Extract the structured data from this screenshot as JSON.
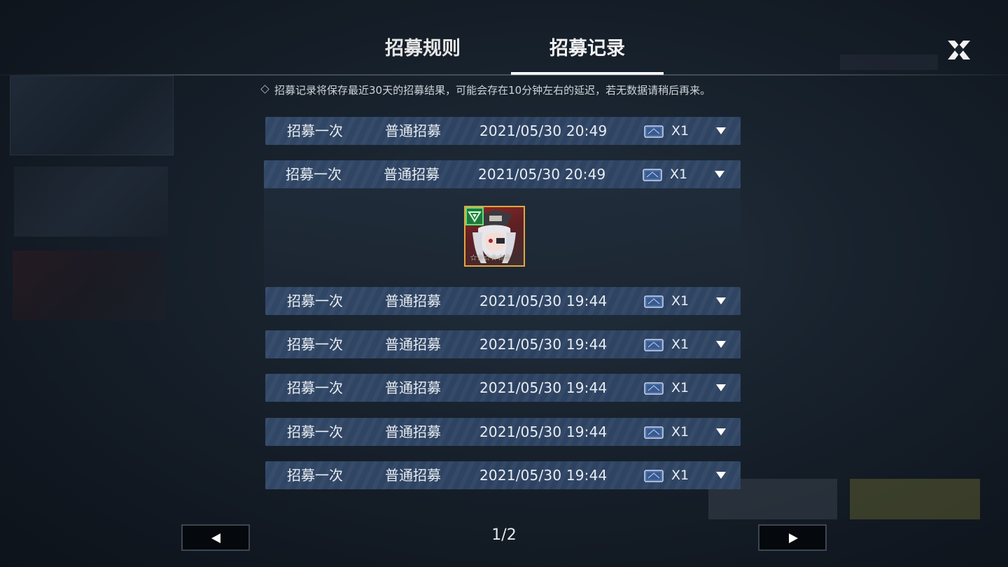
{
  "header": {
    "tabs": [
      {
        "label": "招募规则",
        "active": false
      },
      {
        "label": "招募记录",
        "active": true
      }
    ]
  },
  "notice": {
    "text": "招募记录将保存最近30天的招募结果，可能会存在10分钟左右的延迟，若无数据请稍后再来。"
  },
  "records": [
    {
      "type": "招募一次",
      "pool": "普通招募",
      "time": "2021/05/30 20:49",
      "count": "X1",
      "expanded": false
    },
    {
      "type": "招募一次",
      "pool": "普通招募",
      "time": "2021/05/30 20:49",
      "count": "X1",
      "expanded": true
    },
    {
      "type": "招募一次",
      "pool": "普通招募",
      "time": "2021/05/30 19:44",
      "count": "X1",
      "expanded": false
    },
    {
      "type": "招募一次",
      "pool": "普通招募",
      "time": "2021/05/30 19:44",
      "count": "X1",
      "expanded": false
    },
    {
      "type": "招募一次",
      "pool": "普通招募",
      "time": "2021/05/30 19:44",
      "count": "X1",
      "expanded": false
    },
    {
      "type": "招募一次",
      "pool": "普通招募",
      "time": "2021/05/30 19:44",
      "count": "X1",
      "expanded": false
    },
    {
      "type": "招募一次",
      "pool": "普通招募",
      "time": "2021/05/30 19:44",
      "count": "X1",
      "expanded": false
    }
  ],
  "expanded_result": {
    "character_icon": "character-portrait-icon",
    "stars": "☆☆☆☆☆☆",
    "rarity_color": "#5fe07a"
  },
  "pagination": {
    "indicator": "1/2"
  },
  "colors": {
    "row_bg": "#2f4563",
    "tab_underline": "#ffffff",
    "card_border": "#e3a640"
  }
}
